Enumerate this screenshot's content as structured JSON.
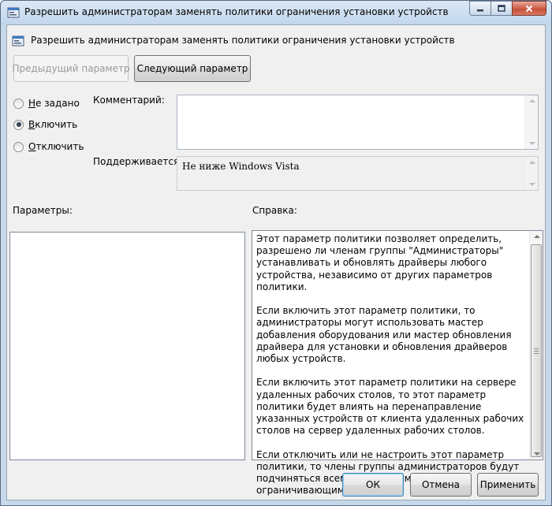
{
  "window": {
    "title": "Разрешить администраторам заменять политики ограничения установки устройств",
    "min_icon": "minimize-icon",
    "max_icon": "maximize-icon",
    "close_icon": "close-icon"
  },
  "header": {
    "policy_name": "Разрешить администраторам заменять политики ограничения установки устройств"
  },
  "nav": {
    "prev_label": "Предыдущий параметр",
    "next_label": "Следующий параметр"
  },
  "state": {
    "options": [
      {
        "accel": "Н",
        "rest": "е задано",
        "checked": false
      },
      {
        "accel": "В",
        "rest": "ключить",
        "checked": true
      },
      {
        "accel": "О",
        "rest": "тключить",
        "checked": false
      }
    ]
  },
  "comment": {
    "label": "Комментарий:",
    "value": ""
  },
  "supported": {
    "label": "Поддерживается:",
    "value": "Не ниже Windows Vista"
  },
  "options_panel": {
    "label": "Параметры:"
  },
  "help": {
    "label": "Справка:",
    "paragraphs": [
      "Этот параметр политики позволяет определить, разрешено ли членам группы \"Администраторы\" устанавливать и обновлять драйверы любого устройства, независимо от других параметров политики.",
      "Если включить этот параметр политики, то администраторы могут использовать мастер добавления оборудования или мастер обновления драйвера для установки и обновления драйверов любых устройств.",
      "Если включить этот параметр политики на сервере удаленных рабочих столов, то этот параметр политики будет влиять на перенаправление указанных устройств от клиента удаленных рабочих столов на сервер удаленных рабочих столов.",
      "Если отключить или не настроить этот параметр политики, то члены группы администраторов будут подчиняться всем параметрам политики, ограничивающим установку"
    ]
  },
  "footer": {
    "ok_label": "ОК",
    "cancel_label": "Отмена",
    "apply_label": "Применить"
  }
}
